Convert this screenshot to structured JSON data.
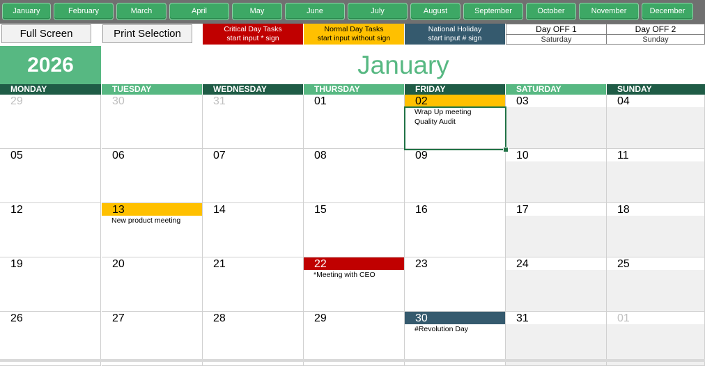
{
  "months": [
    "January",
    "February",
    "March",
    "April",
    "May",
    "June",
    "July",
    "August",
    "September",
    "October",
    "November",
    "December"
  ],
  "buttons": {
    "full_screen": "Full Screen",
    "print_selection": "Print Selection"
  },
  "legend": {
    "critical": {
      "title": "Critical Day Tasks",
      "sub": "start input * sign",
      "color": "#c00000"
    },
    "normal": {
      "title": "Normal Day Tasks",
      "sub": "start input without sign",
      "color": "#ffc000"
    },
    "holiday": {
      "title": "National Holiday",
      "sub": "start input # sign",
      "color": "#355a6e"
    }
  },
  "dayoff": [
    {
      "title": "Day OFF 1",
      "day": "Saturday"
    },
    {
      "title": "Day OFF 2",
      "day": "Sunday"
    }
  ],
  "year": "2026",
  "month_title": "January",
  "weekdays": [
    "MONDAY",
    "TUESDAY",
    "WEDNESDAY",
    "THURSDAY",
    "FRIDAY",
    "SATURDAY",
    "SUNDAY"
  ],
  "colors": {
    "accent": "#57b882",
    "dark_header": "#1f5c46",
    "critical": "#c00000",
    "normal": "#ffc000",
    "holiday": "#355a6e"
  },
  "weeks": [
    [
      {
        "d": "29",
        "dim": true
      },
      {
        "d": "30",
        "dim": true
      },
      {
        "d": "31",
        "dim": true
      },
      {
        "d": "01"
      },
      {
        "d": "02",
        "type": "normal",
        "tasks": [
          "Wrap Up meeting",
          "Quality Audit"
        ]
      },
      {
        "d": "03"
      },
      {
        "d": "04"
      }
    ],
    [
      {
        "d": "05"
      },
      {
        "d": "06"
      },
      {
        "d": "07"
      },
      {
        "d": "08"
      },
      {
        "d": "09"
      },
      {
        "d": "10"
      },
      {
        "d": "11"
      }
    ],
    [
      {
        "d": "12"
      },
      {
        "d": "13",
        "type": "normal",
        "tasks": [
          "New product meeting"
        ]
      },
      {
        "d": "14"
      },
      {
        "d": "15"
      },
      {
        "d": "16"
      },
      {
        "d": "17"
      },
      {
        "d": "18"
      }
    ],
    [
      {
        "d": "19"
      },
      {
        "d": "20"
      },
      {
        "d": "21"
      },
      {
        "d": "22",
        "type": "critical",
        "tasks": [
          "*Meeting with CEO"
        ]
      },
      {
        "d": "23"
      },
      {
        "d": "24"
      },
      {
        "d": "25"
      }
    ],
    [
      {
        "d": "26"
      },
      {
        "d": "27"
      },
      {
        "d": "28"
      },
      {
        "d": "29"
      },
      {
        "d": "30",
        "type": "holiday",
        "tasks": [
          "#Revolution Day"
        ]
      },
      {
        "d": "31"
      },
      {
        "d": "01",
        "dim": true
      }
    ]
  ]
}
